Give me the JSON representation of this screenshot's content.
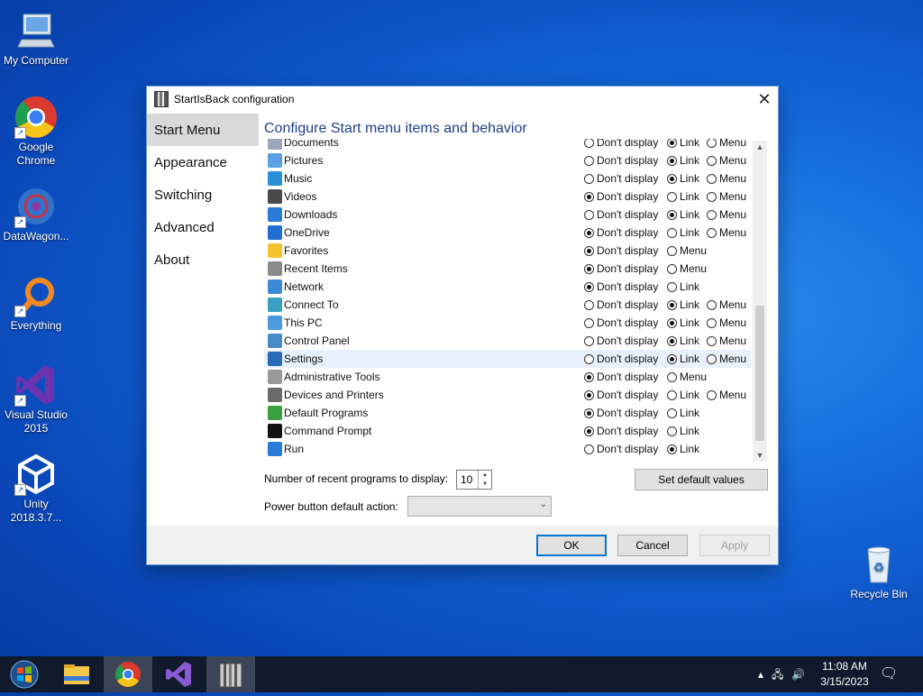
{
  "desktop_icons": [
    {
      "label": "My Computer",
      "icon": "computer-icon"
    },
    {
      "label": "Google Chrome",
      "icon": "chrome-icon"
    },
    {
      "label": "DataWagon...",
      "icon": "datawagon-icon"
    },
    {
      "label": "Everything",
      "icon": "everything-icon"
    },
    {
      "label": "Visual Studio 2015",
      "icon": "visual-studio-icon"
    },
    {
      "label": "Unity 2018.3.7...",
      "icon": "unity-icon"
    },
    {
      "label": "Recycle Bin",
      "icon": "recycle-bin-icon"
    }
  ],
  "dialog": {
    "title": "StartIsBack configuration",
    "heading": "Configure Start menu items and behavior",
    "nav": [
      "Start Menu",
      "Appearance",
      "Switching",
      "Advanced",
      "About"
    ],
    "option_labels": {
      "dont_display": "Don't display",
      "link": "Link",
      "menu": "Menu"
    },
    "items": [
      {
        "label": "Documents",
        "options": [
          "Don't display",
          "Link",
          "Menu"
        ],
        "selected": "Link",
        "color": "#9aa7b8"
      },
      {
        "label": "Pictures",
        "options": [
          "Don't display",
          "Link",
          "Menu"
        ],
        "selected": "Link",
        "color": "#5aa0e0"
      },
      {
        "label": "Music",
        "options": [
          "Don't display",
          "Link",
          "Menu"
        ],
        "selected": "Link",
        "color": "#2a8fd8"
      },
      {
        "label": "Videos",
        "options": [
          "Don't display",
          "Link",
          "Menu"
        ],
        "selected": "Don't display",
        "color": "#4a4a4a"
      },
      {
        "label": "Downloads",
        "options": [
          "Don't display",
          "Link",
          "Menu"
        ],
        "selected": "Link",
        "color": "#2a7ad8"
      },
      {
        "label": "OneDrive",
        "options": [
          "Don't display",
          "Link",
          "Menu"
        ],
        "selected": "Don't display",
        "color": "#1f6fd0"
      },
      {
        "label": "Favorites",
        "options": [
          "Don't display",
          "Menu"
        ],
        "selected": "Don't display",
        "color": "#f3c330"
      },
      {
        "label": "Recent Items",
        "options": [
          "Don't display",
          "Menu"
        ],
        "selected": "Don't display",
        "color": "#8a8a8a"
      },
      {
        "label": "Network",
        "options": [
          "Don't display",
          "Link"
        ],
        "selected": "Don't display",
        "color": "#3a8ad8"
      },
      {
        "label": "Connect To",
        "options": [
          "Don't display",
          "Link",
          "Menu"
        ],
        "selected": "Link",
        "color": "#3aa0c0"
      },
      {
        "label": "This PC",
        "options": [
          "Don't display",
          "Link",
          "Menu"
        ],
        "selected": "Link",
        "color": "#4a9ae0"
      },
      {
        "label": "Control Panel",
        "options": [
          "Don't display",
          "Link",
          "Menu"
        ],
        "selected": "Link",
        "color": "#4a8ac8"
      },
      {
        "label": "Settings",
        "options": [
          "Don't display",
          "Link",
          "Menu"
        ],
        "selected": "Link",
        "color": "#2a6ab8",
        "highlighted": true
      },
      {
        "label": "Administrative Tools",
        "options": [
          "Don't display",
          "Menu"
        ],
        "selected": "Don't display",
        "color": "#9a9a9a"
      },
      {
        "label": "Devices and Printers",
        "options": [
          "Don't display",
          "Link",
          "Menu"
        ],
        "selected": "Don't display",
        "color": "#6a6a6a"
      },
      {
        "label": "Default Programs",
        "options": [
          "Don't display",
          "Link"
        ],
        "selected": "Don't display",
        "color": "#3aa040"
      },
      {
        "label": "Command Prompt",
        "options": [
          "Don't display",
          "Link"
        ],
        "selected": "Don't display",
        "color": "#111111"
      },
      {
        "label": "Run",
        "options": [
          "Don't display",
          "Link"
        ],
        "selected": "Link",
        "color": "#2a7ad8"
      }
    ],
    "recent_label": "Number of recent programs to display:",
    "recent_value": "10",
    "set_default_label": "Set default values",
    "power_label": "Power button default action:",
    "power_value": "",
    "ok_label": "OK",
    "cancel_label": "Cancel",
    "apply_label": "Apply"
  },
  "taskbar": {
    "items": [
      "start-icon",
      "file-explorer-icon",
      "chrome-icon",
      "visual-studio-icon",
      "startisback-icon"
    ],
    "time": "11:08 AM",
    "date": "3/15/2023"
  }
}
